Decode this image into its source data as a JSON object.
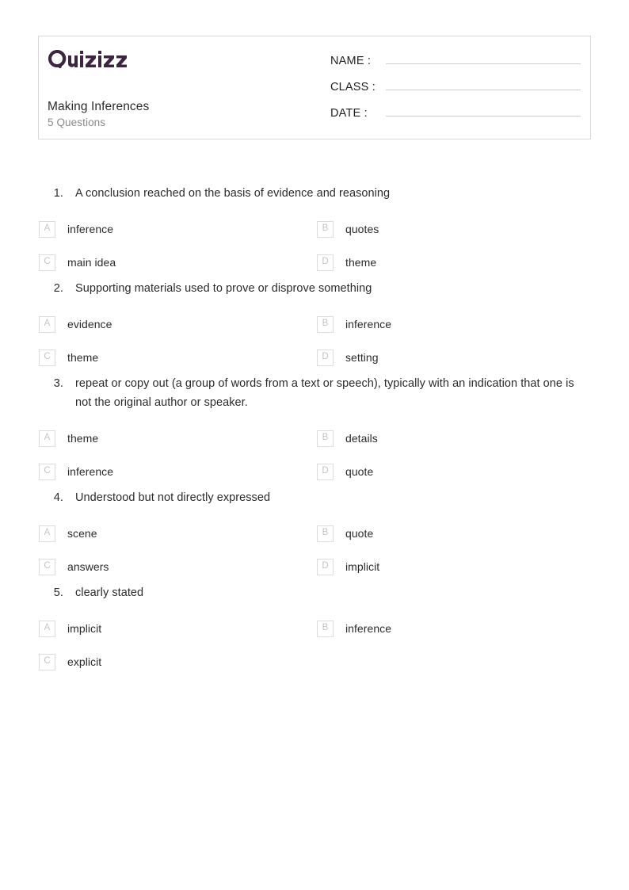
{
  "brand": {
    "logo_text": "Quizizz",
    "logo_color": "#3D2541"
  },
  "header": {
    "quiz_title": "Making Inferences",
    "question_count_label": "5 Questions",
    "fields": [
      {
        "label": "NAME :",
        "value": ""
      },
      {
        "label": "CLASS :",
        "value": ""
      },
      {
        "label": "DATE  :",
        "value": ""
      }
    ]
  },
  "questions": [
    {
      "number": "1.",
      "text": "A conclusion reached on the basis of evidence and reasoning",
      "options": [
        {
          "letter": "A",
          "text": "inference"
        },
        {
          "letter": "B",
          "text": "quotes"
        },
        {
          "letter": "C",
          "text": "main idea"
        },
        {
          "letter": "D",
          "text": "theme"
        }
      ]
    },
    {
      "number": "2.",
      "text": "Supporting materials used to prove or disprove something",
      "options": [
        {
          "letter": "A",
          "text": "evidence"
        },
        {
          "letter": "B",
          "text": "inference"
        },
        {
          "letter": "C",
          "text": "theme"
        },
        {
          "letter": "D",
          "text": "setting"
        }
      ]
    },
    {
      "number": "3.",
      "text": "repeat or copy out (a group of words from a text or speech), typically with an indication that one is not the original author or speaker.",
      "options": [
        {
          "letter": "A",
          "text": "theme"
        },
        {
          "letter": "B",
          "text": "details"
        },
        {
          "letter": "C",
          "text": "inference"
        },
        {
          "letter": "D",
          "text": "quote"
        }
      ]
    },
    {
      "number": "4.",
      "text": "Understood but not directly expressed",
      "options": [
        {
          "letter": "A",
          "text": "scene"
        },
        {
          "letter": "B",
          "text": "quote"
        },
        {
          "letter": "C",
          "text": "answers"
        },
        {
          "letter": "D",
          "text": "implicit"
        }
      ]
    },
    {
      "number": "5.",
      "text": "clearly stated",
      "options": [
        {
          "letter": "A",
          "text": "implicit"
        },
        {
          "letter": "B",
          "text": "inference"
        },
        {
          "letter": "C",
          "text": "explicit"
        }
      ]
    }
  ]
}
